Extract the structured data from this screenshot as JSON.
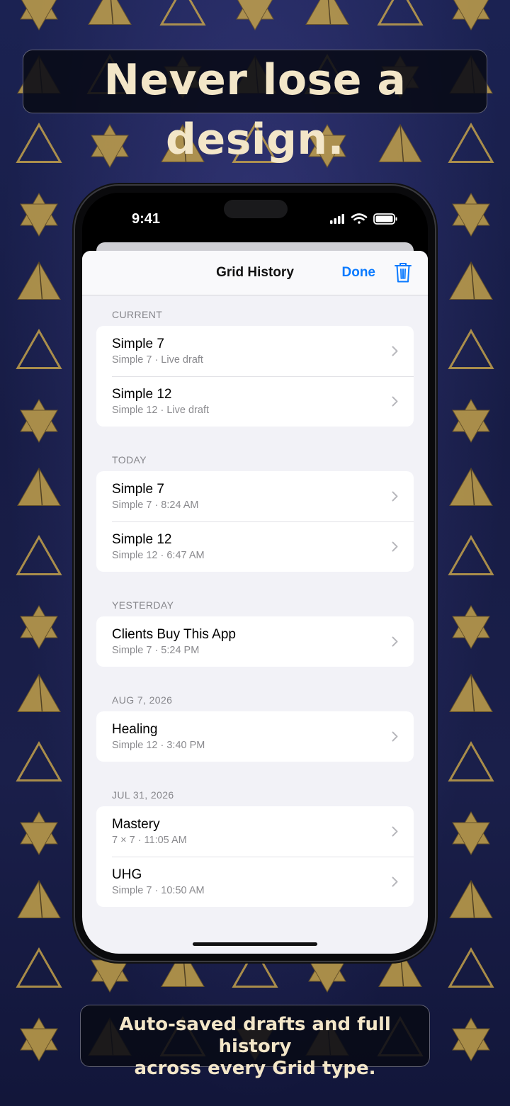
{
  "headline": "Never lose a design.",
  "caption_line1": "Auto-saved drafts and full history",
  "caption_line2": "across every Grid type.",
  "status_bar": {
    "time": "9:41"
  },
  "nav": {
    "title": "Grid History",
    "done_label": "Done"
  },
  "sections": [
    {
      "header": "CURRENT",
      "rows": [
        {
          "title": "Simple 7",
          "subtitle": "Simple 7 · Live draft"
        },
        {
          "title": "Simple 12",
          "subtitle": "Simple 12 · Live draft"
        }
      ]
    },
    {
      "header": "TODAY",
      "rows": [
        {
          "title": "Simple 7",
          "subtitle": "Simple 7 · 8:24 AM"
        },
        {
          "title": "Simple 12",
          "subtitle": "Simple 12 · 6:47 AM"
        }
      ]
    },
    {
      "header": "YESTERDAY",
      "rows": [
        {
          "title": "Clients Buy This App",
          "subtitle": "Simple 7 · 5:24 PM"
        }
      ]
    },
    {
      "header": "AUG 7, 2026",
      "rows": [
        {
          "title": "Healing",
          "subtitle": "Simple 12 · 3:40 PM"
        }
      ]
    },
    {
      "header": "JUL 31, 2026",
      "rows": [
        {
          "title": "Mastery",
          "subtitle": "7 × 7 · 11:05 AM"
        },
        {
          "title": "UHG",
          "subtitle": "Simple 7 · 10:50 AM"
        }
      ]
    }
  ],
  "icons": {
    "status": [
      "cellular-signal-icon",
      "wifi-icon",
      "battery-icon"
    ],
    "nav": [
      "trash-icon"
    ],
    "row": "chevron-right-icon",
    "background": [
      "star-tetrahedron-icon",
      "cube-icon",
      "pyramid-icon",
      "spiral-icon",
      "triangle-icon",
      "dodecahedron-icon"
    ]
  },
  "colors": {
    "accent": "#0a7aff",
    "headline_text": "#f3e6c8",
    "background": "#171c45",
    "gold_pattern": "#c9a64a"
  }
}
